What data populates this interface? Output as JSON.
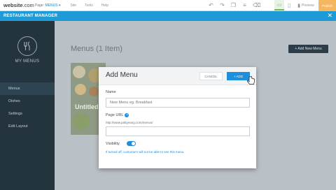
{
  "topbar": {
    "logo_prefix": "website",
    "logo_suffix": ".com",
    "page_label": "Page:",
    "page_value": "MENUS",
    "nav": [
      "Site",
      "Tools",
      "Help"
    ],
    "preview": "Preview",
    "publish": "Publish"
  },
  "app": {
    "title": "RESTAURANT MANAGER"
  },
  "sidebar": {
    "title": "MY MENUS",
    "items": [
      {
        "label": "Menus"
      },
      {
        "label": "Dishes"
      },
      {
        "label": "Settings"
      },
      {
        "label": "Edit Layout"
      }
    ]
  },
  "main": {
    "title": "Menus (1 Item)",
    "add_new_label": "+ Add New Menu",
    "card_text": "Untitled"
  },
  "modal": {
    "title": "Add Menu",
    "cancel_label": "CANCEL",
    "add_label": "+ ADD",
    "name_label": "Name",
    "name_value": "New Menu eg. Breakfast",
    "url_label": "Page URL",
    "url_hint": "http://www.pattyeang.com/menus/",
    "url_value": "",
    "visibility_label": "Visibility",
    "visibility_on": true,
    "visibility_note": "If turned off, customers will not be able to see this menu."
  },
  "colors": {
    "accent": "#1e9ad6",
    "sidebar_bg": "#23343e",
    "publish": "#f5b75d"
  }
}
